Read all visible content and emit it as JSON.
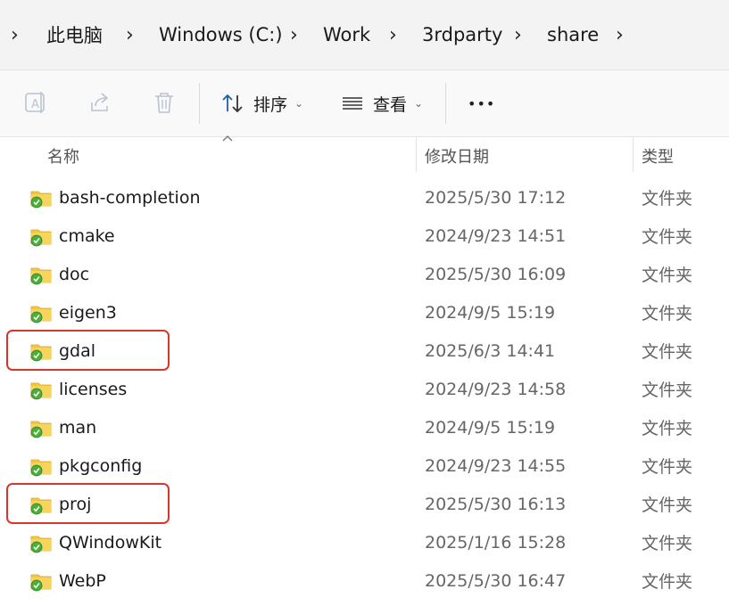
{
  "breadcrumb": {
    "items": [
      "此电脑",
      "Windows (C:)",
      "Work",
      "3rdparty",
      "share"
    ]
  },
  "toolbar": {
    "sort_label": "排序",
    "view_label": "查看",
    "more_label": "•••"
  },
  "columns": {
    "name": "名称",
    "date": "修改日期",
    "type": "类型"
  },
  "files": [
    {
      "name": "bash-completion",
      "date": "2025/5/30 17:12",
      "type": "文件夹",
      "highlighted": false
    },
    {
      "name": "cmake",
      "date": "2024/9/23 14:51",
      "type": "文件夹",
      "highlighted": false
    },
    {
      "name": "doc",
      "date": "2025/5/30 16:09",
      "type": "文件夹",
      "highlighted": false
    },
    {
      "name": "eigen3",
      "date": "2024/9/5 15:19",
      "type": "文件夹",
      "highlighted": false
    },
    {
      "name": "gdal",
      "date": "2025/6/3 14:41",
      "type": "文件夹",
      "highlighted": true
    },
    {
      "name": "licenses",
      "date": "2024/9/23 14:58",
      "type": "文件夹",
      "highlighted": false
    },
    {
      "name": "man",
      "date": "2024/9/5 15:19",
      "type": "文件夹",
      "highlighted": false
    },
    {
      "name": "pkgconfig",
      "date": "2024/9/23 14:55",
      "type": "文件夹",
      "highlighted": false
    },
    {
      "name": "proj",
      "date": "2025/5/30 16:13",
      "type": "文件夹",
      "highlighted": true
    },
    {
      "name": "QWindowKit",
      "date": "2025/1/16 15:28",
      "type": "文件夹",
      "highlighted": false
    },
    {
      "name": "WebP",
      "date": "2025/5/30 16:47",
      "type": "文件夹",
      "highlighted": false
    }
  ],
  "colors": {
    "folder": "#f4c542",
    "sync_badge": "#4caf3a",
    "highlight": "#d9362b"
  }
}
